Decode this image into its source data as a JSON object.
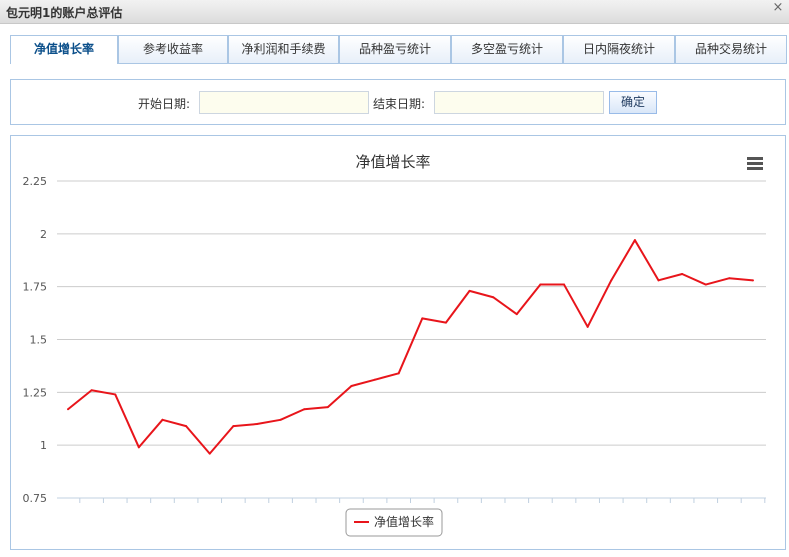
{
  "window": {
    "title": "包元明1的账户总评估",
    "close_glyph": "×"
  },
  "tabs": [
    {
      "label": "净值增长率",
      "active": true
    },
    {
      "label": "参考收益率",
      "active": false
    },
    {
      "label": "净利润和手续费",
      "active": false
    },
    {
      "label": "品种盈亏统计",
      "active": false
    },
    {
      "label": "多空盈亏统计",
      "active": false
    },
    {
      "label": "日内隔夜统计",
      "active": false
    },
    {
      "label": "品种交易统计",
      "active": false
    }
  ],
  "filter": {
    "start_label": "开始日期:",
    "start_value": "",
    "end_label": "结束日期:",
    "end_value": "",
    "confirm_label": "确定"
  },
  "chart_data": {
    "type": "line",
    "title": "净值增长率",
    "xlabel": "",
    "ylabel": "",
    "ylim": [
      0.75,
      2.25
    ],
    "yticks": [
      "0.75",
      "1",
      "1.25",
      "1.5",
      "1.75",
      "2",
      "2.25"
    ],
    "grid": true,
    "legend": "bottom-center",
    "menu_icon": "hamburger-menu-icon",
    "series": [
      {
        "name": "净值增长率",
        "color": "#e8151b",
        "values": [
          1.17,
          1.26,
          1.24,
          0.99,
          1.12,
          1.09,
          0.96,
          1.09,
          1.1,
          1.12,
          1.17,
          1.18,
          1.28,
          1.31,
          1.34,
          1.6,
          1.58,
          1.73,
          1.7,
          1.62,
          1.76,
          1.76,
          1.56,
          1.78,
          1.97,
          1.78,
          1.81,
          1.76,
          1.79,
          1.78
        ]
      }
    ]
  }
}
